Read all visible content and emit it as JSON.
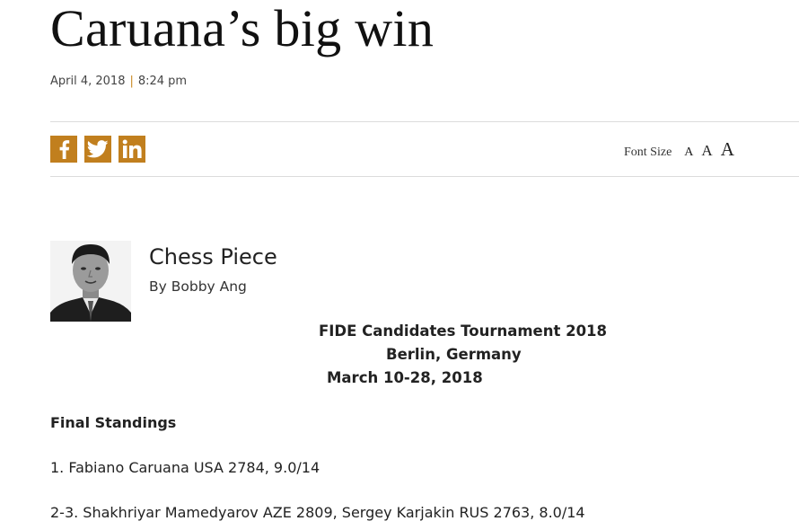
{
  "article": {
    "headline": "Caruana’s big win",
    "date": "April 4, 2018",
    "separator": "|",
    "time": "8:24 pm"
  },
  "share": {
    "facebook_icon": "facebook-icon",
    "twitter_icon": "twitter-icon",
    "linkedin_icon": "linkedin-icon",
    "brand_color": "#c17f1e"
  },
  "font_size": {
    "label": "Font Size",
    "small": "A",
    "medium": "A",
    "large": "A"
  },
  "column": {
    "name": "Chess Piece",
    "byline": "By Bobby Ang"
  },
  "body": {
    "event_title": "FIDE Candidates Tournament 2018",
    "event_location": "Berlin, Germany",
    "event_dates": "March 10-28, 2018",
    "standings_heading": "Final Standings",
    "standing_1": "1. Fabiano Caruana USA 2784, 9.0/14",
    "standing_2": "2-3. Shakhriyar Mamedyarov AZE 2809, Sergey Karjakin RUS 2763, 8.0/14"
  }
}
